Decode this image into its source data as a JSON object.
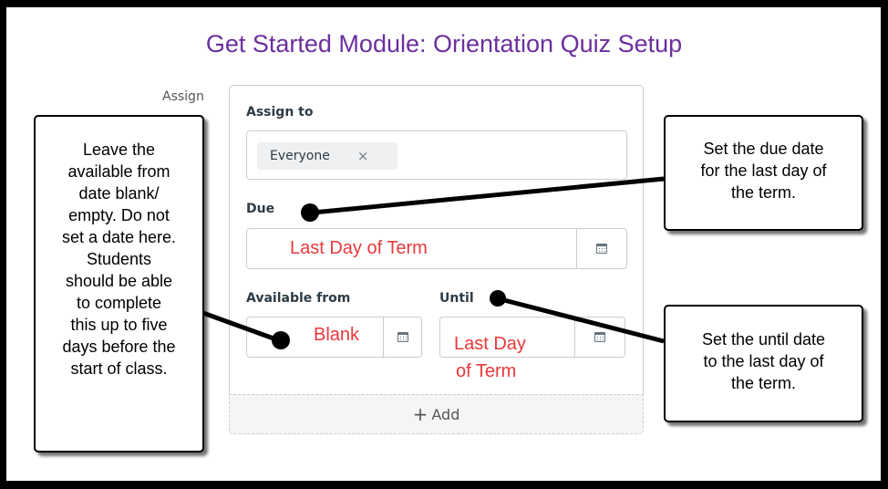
{
  "page": {
    "title": "Get Started Module: Orientation Quiz Setup",
    "assign_side_label": "Assign"
  },
  "assign_card": {
    "assign_to_label": "Assign to",
    "assignee_chip": "Everyone",
    "remove_chip_glyph": "×",
    "due_label": "Due",
    "due_value": "Last Day of Term",
    "available_from_label": "Available from",
    "available_from_value": "Blank",
    "until_label": "Until",
    "until_value_line1": "Last Day",
    "until_value_line2": "of Term",
    "add_button_icon": "+",
    "add_button_label": "Add"
  },
  "callouts": {
    "left": [
      "Leave the",
      "available from",
      "date blank/",
      "empty. Do not",
      "set a date here.",
      "Students",
      "should be able",
      "to complete",
      "this up to five",
      "days before the",
      "start of class."
    ],
    "due": [
      "Set the due date",
      "for the last day of",
      "the term."
    ],
    "until": [
      "Set the until date",
      "to the last day of",
      "the term."
    ]
  },
  "icons": {
    "calendar": "calendar-icon",
    "close": "close-icon",
    "plus": "plus-icon"
  },
  "colors": {
    "title": "#6b2f9e",
    "annotation_text": "#e8383b",
    "frame": "#000000",
    "field_border": "#c7cdd1"
  }
}
